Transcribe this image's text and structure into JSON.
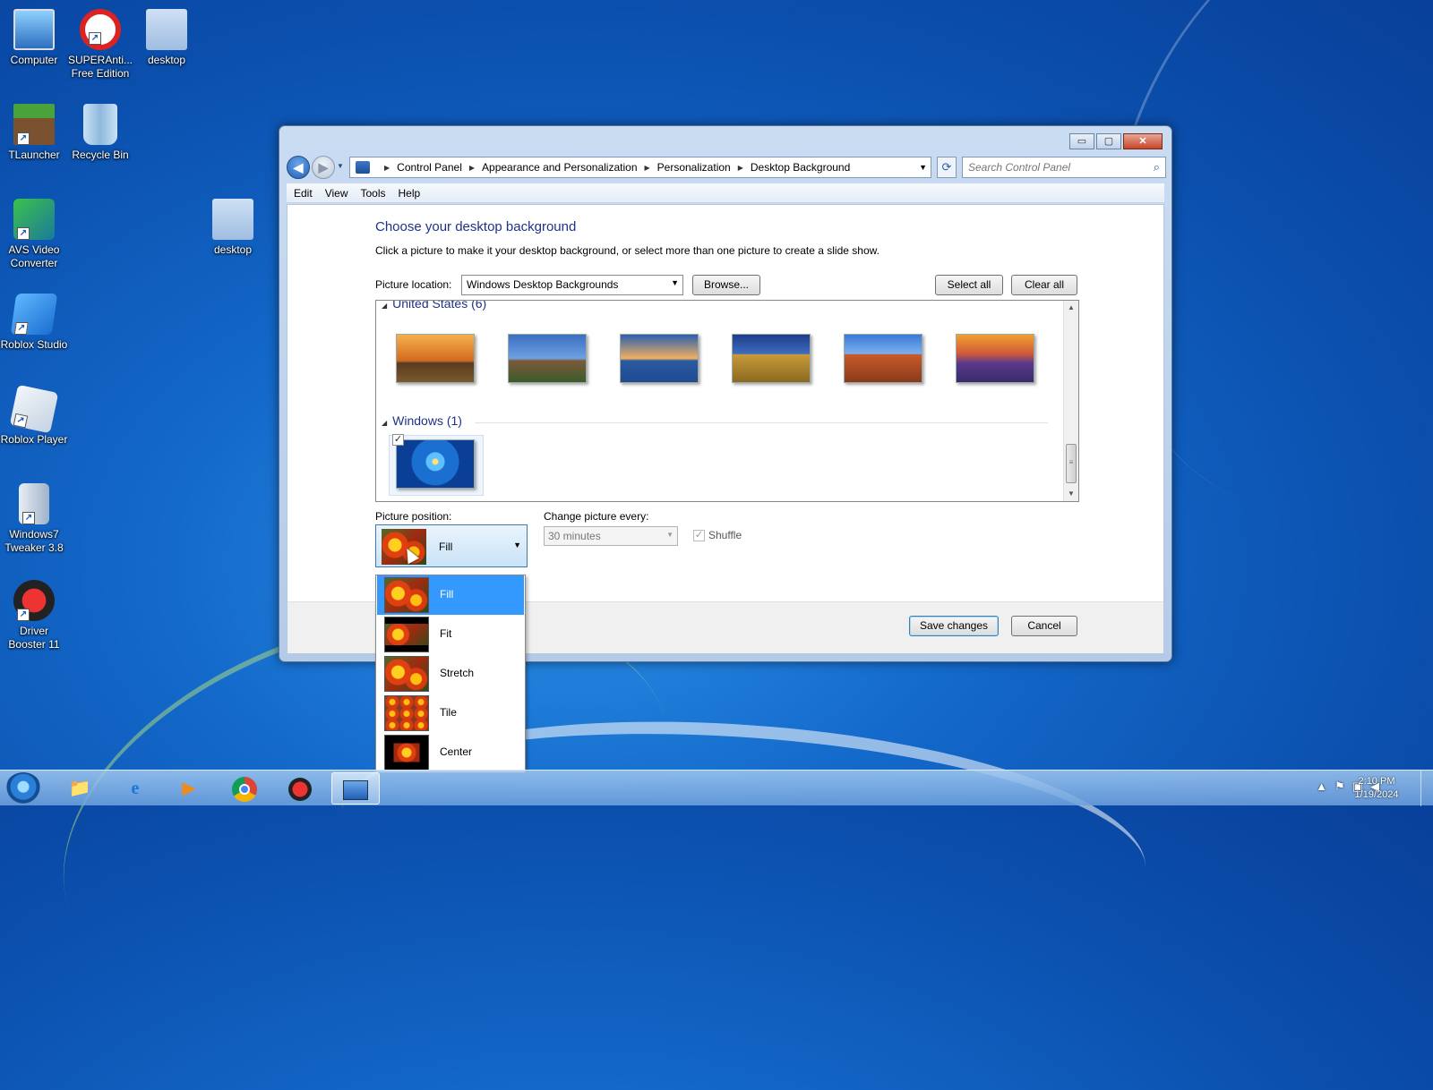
{
  "desktop": {
    "icons": [
      {
        "label": "Computer"
      },
      {
        "label": "SUPERAnti... Free Edition"
      },
      {
        "label": "desktop"
      },
      {
        "label": "TLauncher"
      },
      {
        "label": "Recycle Bin"
      },
      {
        "label": "AVS Video Converter"
      },
      {
        "label": "desktop"
      },
      {
        "label": "Roblox Studio"
      },
      {
        "label": "Roblox Player"
      },
      {
        "label": "Windows7 Tweaker 3.8"
      },
      {
        "label": "Driver Booster 11"
      }
    ]
  },
  "window": {
    "caption": {
      "minimize": "▭",
      "maximize": "▢",
      "close": "✕"
    },
    "breadcrumb": [
      "Control Panel",
      "Appearance and Personalization",
      "Personalization",
      "Desktop Background"
    ],
    "search_placeholder": "Search Control Panel",
    "menu": [
      "Edit",
      "View",
      "Tools",
      "Help"
    ],
    "title": "Choose your desktop background",
    "description": "Click a picture to make it your desktop background, or select more than one picture to create a slide show.",
    "picture_location_label": "Picture location:",
    "picture_location_value": "Windows Desktop Backgrounds",
    "browse_label": "Browse...",
    "select_all_label": "Select all",
    "clear_all_label": "Clear all",
    "groups": [
      {
        "name": "United States (6)",
        "thumbs": 6
      },
      {
        "name": "Windows (1)",
        "thumbs": 1
      }
    ],
    "picture_position_label": "Picture position:",
    "picture_position_value": "Fill",
    "change_every_label": "Change picture every:",
    "change_every_value": "30 minutes",
    "shuffle_label": "Shuffle",
    "position_options": [
      "Fill",
      "Fit",
      "Stretch",
      "Tile",
      "Center"
    ],
    "save_label": "Save changes",
    "cancel_label": "Cancel"
  },
  "taskbar": {
    "clock_time": "2:10 PM",
    "clock_date": "1/19/2024"
  }
}
